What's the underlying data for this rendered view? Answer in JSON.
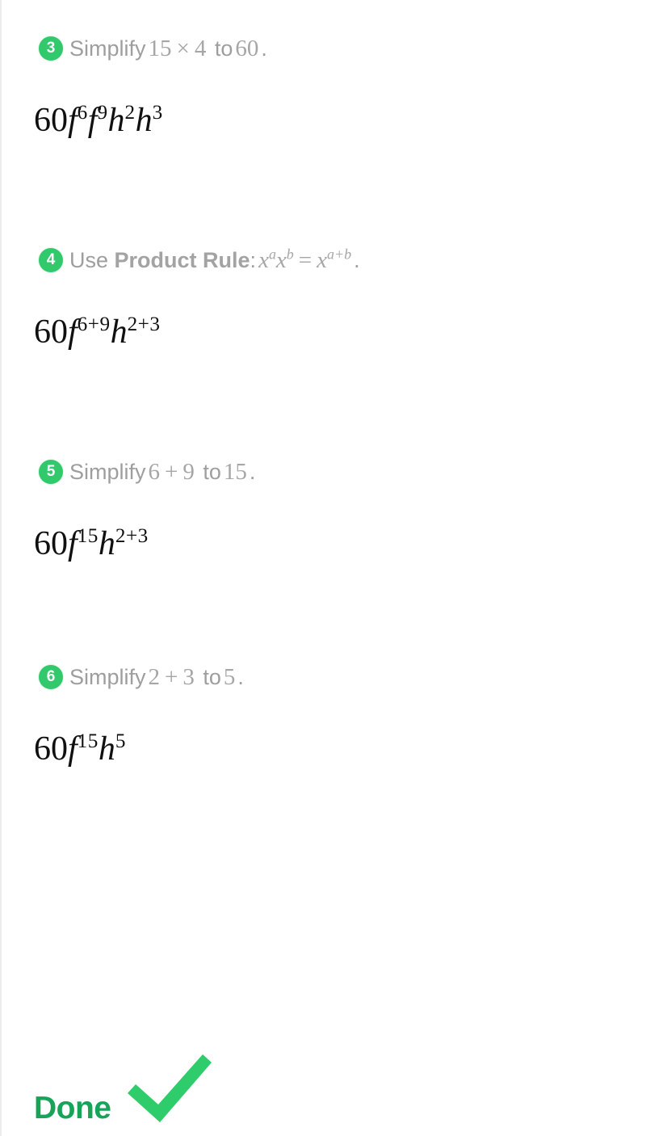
{
  "theme": {
    "background": "#ffffff",
    "badge_green": "#31c96c",
    "check_green": "#2ecc6a",
    "done_green": "#17a358",
    "header_gray": "#9e9e9e",
    "math_black": "#101010",
    "edge_line": "#ececec"
  },
  "steps": [
    {
      "number": "3",
      "head_prefix": "Simplify",
      "head_math": {
        "a": "15",
        "op": "×",
        "b": "4"
      },
      "head_middle": "to",
      "head_value": "60",
      "head_suffix": ".",
      "result": {
        "coefficient": "60",
        "terms": [
          {
            "base": "f",
            "exp": "6"
          },
          {
            "base": "f",
            "exp": "9"
          },
          {
            "base": "h",
            "exp": "2"
          },
          {
            "base": "h",
            "exp": "3"
          }
        ]
      }
    },
    {
      "number": "4",
      "head_prefix": "Use",
      "head_strong": "Product Rule",
      "head_colon": ":",
      "rule": {
        "lhs_base_1": "x",
        "lhs_exp_1": "a",
        "lhs_base_2": "x",
        "lhs_exp_2": "b",
        "equals": "=",
        "rhs_base": "x",
        "rhs_exp": "a+b"
      },
      "head_suffix": ".",
      "result": {
        "coefficient": "60",
        "terms": [
          {
            "base": "f",
            "exp": "6+9"
          },
          {
            "base": "h",
            "exp": "2+3"
          }
        ]
      }
    },
    {
      "number": "5",
      "head_prefix": "Simplify",
      "head_math": {
        "a": "6",
        "op": "+",
        "b": "9"
      },
      "head_middle": "to",
      "head_value": "15",
      "head_suffix": ".",
      "result": {
        "coefficient": "60",
        "terms": [
          {
            "base": "f",
            "exp": "15"
          },
          {
            "base": "h",
            "exp": "2+3"
          }
        ]
      }
    },
    {
      "number": "6",
      "head_prefix": "Simplify",
      "head_math": {
        "a": "2",
        "op": "+",
        "b": "3"
      },
      "head_middle": "to",
      "head_value": "5",
      "head_suffix": ".",
      "result": {
        "coefficient": "60",
        "terms": [
          {
            "base": "f",
            "exp": "15"
          },
          {
            "base": "h",
            "exp": "5"
          }
        ]
      }
    }
  ],
  "footer": {
    "done_label": "Done",
    "check_icon": "checkmark-icon"
  }
}
